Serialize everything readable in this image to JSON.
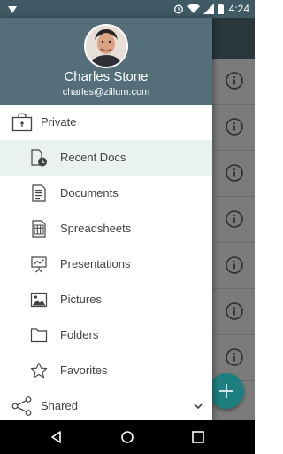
{
  "status_bar": {
    "time": "4:24",
    "icons": [
      "android-debug-icon",
      "alarm-icon",
      "wifi-icon",
      "signal-icon",
      "battery-icon"
    ]
  },
  "drawer": {
    "header": {
      "name": "Charles Stone",
      "email": "charles@zillum.com"
    },
    "sections": {
      "private": {
        "label": "Private",
        "icon": "lock-folder-icon"
      },
      "shared": {
        "label": "Shared",
        "icon": "share-icon"
      }
    },
    "items": [
      {
        "label": "Recent Docs",
        "icon": "recent-docs-icon",
        "selected": true
      },
      {
        "label": "Documents",
        "icon": "document-icon",
        "selected": false
      },
      {
        "label": "Spreadsheets",
        "icon": "spreadsheet-icon",
        "selected": false
      },
      {
        "label": "Presentations",
        "icon": "presentation-icon",
        "selected": false
      },
      {
        "label": "Pictures",
        "icon": "picture-icon",
        "selected": false
      },
      {
        "label": "Folders",
        "icon": "folder-icon",
        "selected": false
      },
      {
        "label": "Favorites",
        "icon": "star-icon",
        "selected": false
      }
    ]
  },
  "colors": {
    "header_bg": "#546e7a",
    "selected_bg": "#e9f1f1",
    "fab": "#1d7f7f",
    "text": "#424242"
  }
}
